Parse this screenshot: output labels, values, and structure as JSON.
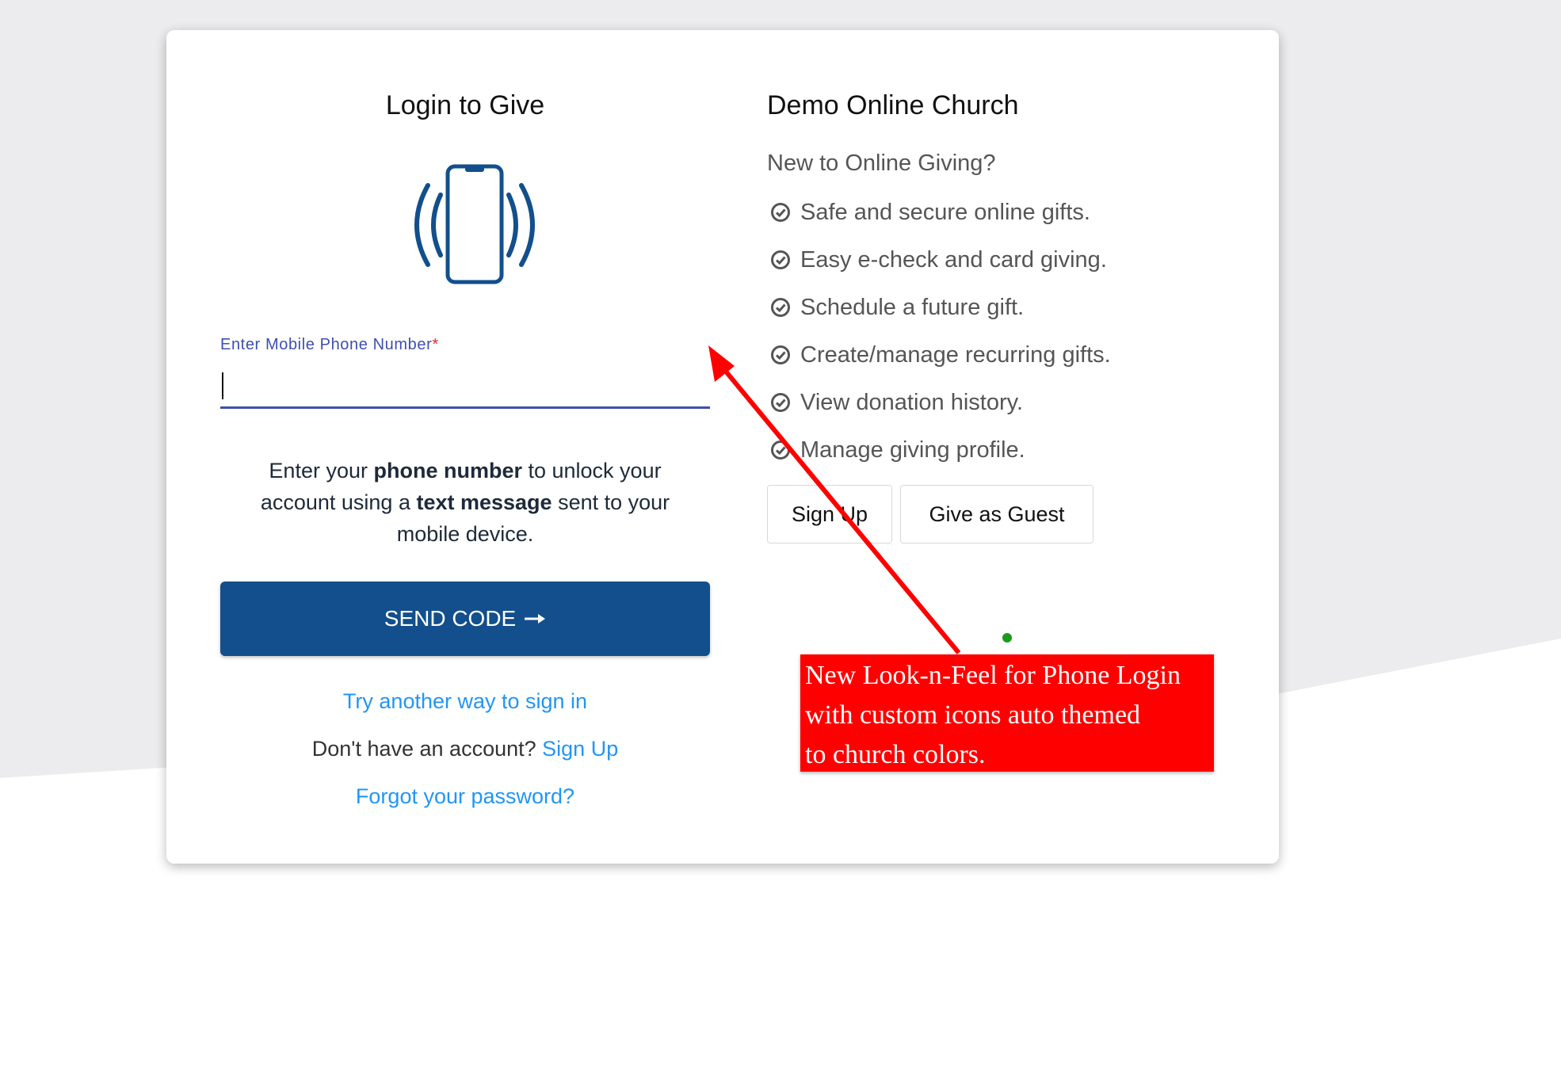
{
  "colors": {
    "primary": "#124f8c",
    "link": "#2196f3",
    "field_accent": "#3e4fb0",
    "annotation_red": "#ff0000"
  },
  "login": {
    "title": "Login to Give",
    "icon": "phone-vibrating-icon",
    "phone_label": "Enter Mobile Phone Number",
    "phone_required_mark": "*",
    "phone_value": "",
    "instructions": {
      "part1": "Enter your ",
      "bold1": "phone number",
      "part2": " to unlock your account using a ",
      "bold2": "text message",
      "part3": " sent to your mobile device."
    },
    "send_code_label": "SEND CODE",
    "send_code_icon": "arrow-right-icon",
    "try_another_link": "Try another way to sign in",
    "no_account_text": "Don't have an account?",
    "no_account_link": "Sign Up",
    "forgot_link": "Forgot your password?"
  },
  "church": {
    "name": "Demo Online Church",
    "subtitle": "New to Online Giving?",
    "benefits": [
      "Safe and secure online gifts.",
      "Easy e-check and card giving.",
      "Schedule a future gift.",
      "Create/manage recurring gifts.",
      "View donation history.",
      "Manage giving profile."
    ],
    "benefit_icon": "check-circle-icon",
    "signup_button": "Sign Up",
    "guest_button": "Give as Guest"
  },
  "annotation": {
    "lines": [
      "New Look-n-Feel for Phone Login",
      "with custom icons auto themed",
      "to church colors."
    ]
  }
}
